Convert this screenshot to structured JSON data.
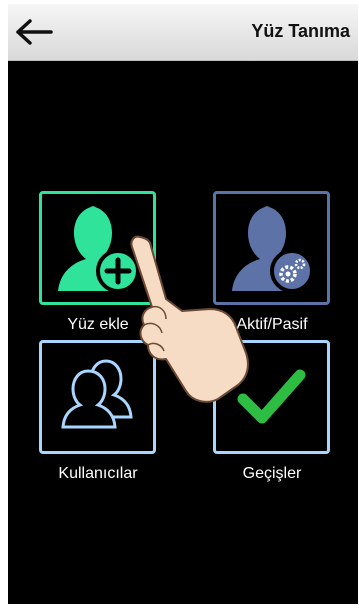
{
  "header": {
    "title": "Yüz Tanıma",
    "back_icon": "arrow-left-icon"
  },
  "tiles": [
    {
      "label": "Yüz ekle",
      "icon": "add-user-icon",
      "color": "#2fe39a"
    },
    {
      "label": "Aktif/Pasif",
      "icon": "user-settings-icon",
      "color": "#5d73a8"
    },
    {
      "label": "Kullanıcılar",
      "icon": "users-icon",
      "color": "#a9d6ff"
    },
    {
      "label": "Geçişler",
      "icon": "checkmark-icon",
      "color": "#2ebd43"
    }
  ],
  "overlay": {
    "icon": "pointing-hand-icon"
  }
}
